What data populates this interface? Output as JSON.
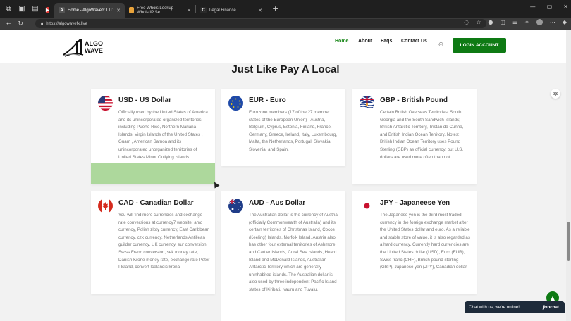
{
  "browser": {
    "tabs": [
      {
        "title": "Home - AlgoWavefx LTD",
        "favicon": "A",
        "color": "#555555"
      },
      {
        "title": "Free Whois Lookup - Whois IP Se",
        "favicon": "",
        "color": "#e8a33b"
      },
      {
        "title": "Legal Finance",
        "favicon": "C",
        "color": "#2a2a2a"
      }
    ],
    "url": "https://algowavefx.live"
  },
  "site": {
    "logo": {
      "line1": "ALGO",
      "line2": "WAVE"
    },
    "nav": [
      "Home",
      "About",
      "Faqs",
      "Contact Us"
    ],
    "login_label": "LOGIN ACCOUNT",
    "section_title": "Just Like Pay A Local"
  },
  "cards": [
    {
      "flag": "usa-flag",
      "title": "USD - US Dollar",
      "body": "Officially used by the United States of America and its unincorporated organized territories including Puerto Rico, Northern Mariana Islands, Virgin Islands of the United States , Guam , American Samoa and its unincorporated unorganized territories of United States Minor Outlying Islands."
    },
    {
      "flag": "eu-flag",
      "title": "EUR - Euro",
      "body": "Eurozone members (17 of the 27 member states of the European Union) - Austria, Belgium, Cyprus, Estonia, Finland, France, Germany, Greece, Ireland, Italy, Luxembourg, Malta, the Netherlands, Portugal, Slovakia, Slovenia, and Spain."
    },
    {
      "flag": "british-territory-flag",
      "title": "GBP - British Pound",
      "body": "Certain British Overseas Territories: South Georgia and the South Sandwich Islands; British Antarctic Territory, Tristan da Cunha, and British Indian Ocean Territory. Notes: British Indian Ocean Territory uses Pound Sterling (GBP) as official currency, but U.S. dollars are used more often than not."
    },
    {
      "flag": "canada-flag",
      "title": "CAD - Canadian Dollar",
      "body": "You will find more currencies and exchange rate conversions at currency7 website: amd currency, Polish zloty currency, East Caribbean currency, czk currency, Netherlands Antillean guilder currency, UK currency, eur conversion, Swiss Franc conversion, sek money rate, Danish Krone money rate, exchange rate Peter I Island, convert Icelandic krona"
    },
    {
      "flag": "australia-flag",
      "title": "AUD - Aus Dollar",
      "body": "The Australian dollar is the currency of Austria (officially Commonwealth of Australia) and its certain territories of Christmas Island, Cocos (Keeling) Islands, Norfolk Island. Austria also has other four external territories of Ashmore and Cartier Islands, Coral Sea Islands, Heard Island and McDonald Islands, Australian Antarctic Territory which are generally uninhabited islands. The Australian dollar is also used by three independent Pacific Island states of Kiribati, Nauru and Tuvalu."
    },
    {
      "flag": "japan-flag",
      "title": "JPY - Japaneese Yen",
      "body": "The Japanese yen is the third most traded currency in the foreign exchange market after the United States dollar and euro. As a reliable and stable store of value, it is also regarded as a hard currency. Currently hard currencies are the United States dollar (USD), Euro (EUR), Swiss franc (CHF), British pound sterling (GBP), Japanese yen (JPY), Canadian dollar"
    }
  ],
  "chat": {
    "label": "Chat with us, we're online!",
    "brand": "jivochat"
  }
}
